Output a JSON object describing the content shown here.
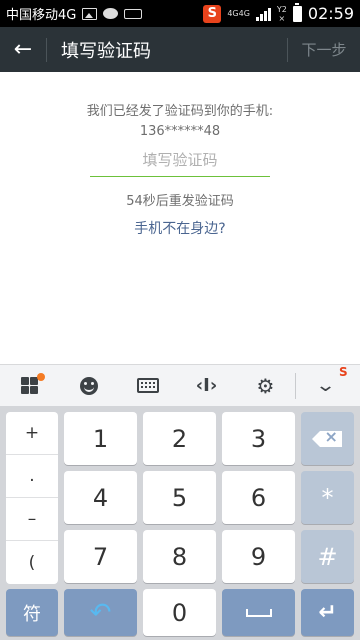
{
  "statusbar": {
    "carrier": "中国移动4G",
    "network_top": "4G4G",
    "network_bottom": "",
    "alt_top": "Y2",
    "alt_bottom": "×",
    "time": "02:59",
    "icons": [
      "image-icon",
      "chat-icon",
      "keyboard-icon",
      "sogou-icon",
      "signal-icon",
      "battery-icon"
    ]
  },
  "appbar": {
    "title": "填写验证码",
    "next_label": "下一步"
  },
  "content": {
    "prompt": "我们已经发了验证码到你的手机:",
    "phone": "136******48",
    "code_placeholder": "填写验证码",
    "code_value": "",
    "resend": "54秒后重发验证码",
    "help_link": "手机不在身边?"
  },
  "keyboard": {
    "toolbar": [
      "menu-grid-icon",
      "emoji-icon",
      "keyboard-icon",
      "cursor-icon",
      "settings-icon",
      "collapse-icon"
    ],
    "symbols": [
      "+",
      ".",
      "–",
      "("
    ],
    "digits": [
      "1",
      "2",
      "3",
      "4",
      "5",
      "6",
      "7",
      "8",
      "9",
      "0"
    ],
    "right_keys": [
      "*",
      "#"
    ],
    "symbol_key": "符",
    "accent_color": "#7e9ac0",
    "undo_color": "#58b9f0"
  }
}
